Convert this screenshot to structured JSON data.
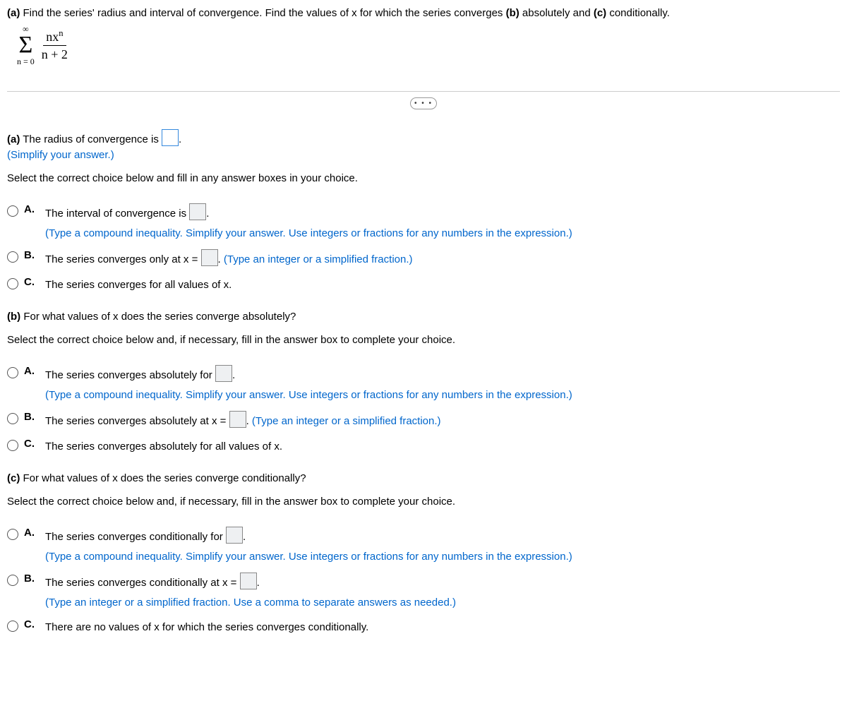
{
  "problem": {
    "intro_bold_1": "(a)",
    "intro_text_1": " Find the ",
    "intro_span_series": "series'",
    "intro_text_2": " radius and interval of convergence. Find the values of x for which the series converges ",
    "intro_bold_2": "(b)",
    "intro_text_3": " absolutely and ",
    "intro_bold_3": "(c)",
    "intro_text_4": " conditionally."
  },
  "formula": {
    "upper": "∞",
    "lower": "n = 0",
    "num_left": "nx",
    "num_sup": "n",
    "den": "n + 2"
  },
  "dots": "• • •",
  "partA": {
    "q_bold": "(a)",
    "q_text_1": " The radius of convergence is ",
    "q_text_2": ".",
    "simplify": "(Simplify your answer.)",
    "instr": "Select the correct choice below and fill in any answer boxes in your choice.",
    "A": {
      "label": "A.",
      "t1": "The interval of convergence is ",
      "t2": ".",
      "sub": "(Type a compound inequality. Simplify your answer. Use integers or fractions for any numbers in the expression.)"
    },
    "B": {
      "label": "B.",
      "t1": "The series converges only at x = ",
      "t2": ". ",
      "sub": "(Type an integer or a simplified fraction.)"
    },
    "C": {
      "label": "C.",
      "t1": "The series converges for all values of x."
    }
  },
  "partB": {
    "q_bold": "(b)",
    "q_text": " For what values of x does the series converge absolutely?",
    "instr": "Select the correct choice below and, if necessary, fill in the answer box to complete your choice.",
    "A": {
      "label": "A.",
      "t1": "The series converges absolutely for ",
      "t2": ".",
      "sub": "(Type a compound inequality. Simplify your answer. Use integers or fractions for any numbers in the expression.)"
    },
    "B": {
      "label": "B.",
      "t1": "The series converges absolutely at x = ",
      "t2": ". ",
      "sub": "(Type an integer or a simplified fraction.)"
    },
    "C": {
      "label": "C.",
      "t1": "The series converges absolutely for all values of x."
    }
  },
  "partC": {
    "q_bold": "(c)",
    "q_text": " For what values of x does the series converge conditionally?",
    "instr": "Select the correct choice below and, if necessary, fill in the answer box to complete your choice.",
    "A": {
      "label": "A.",
      "t1": "The series converges conditionally for ",
      "t2": ".",
      "sub": "(Type a compound inequality. Simplify your answer. Use integers or fractions for any numbers in the expression.)"
    },
    "B": {
      "label": "B.",
      "t1": "The series converges conditionally at x = ",
      "t2": ".",
      "sub": "(Type an integer or a simplified fraction. Use a comma to separate answers as needed.)"
    },
    "C": {
      "label": "C.",
      "t1": "There are no values of x for which the series converges conditionally."
    }
  }
}
